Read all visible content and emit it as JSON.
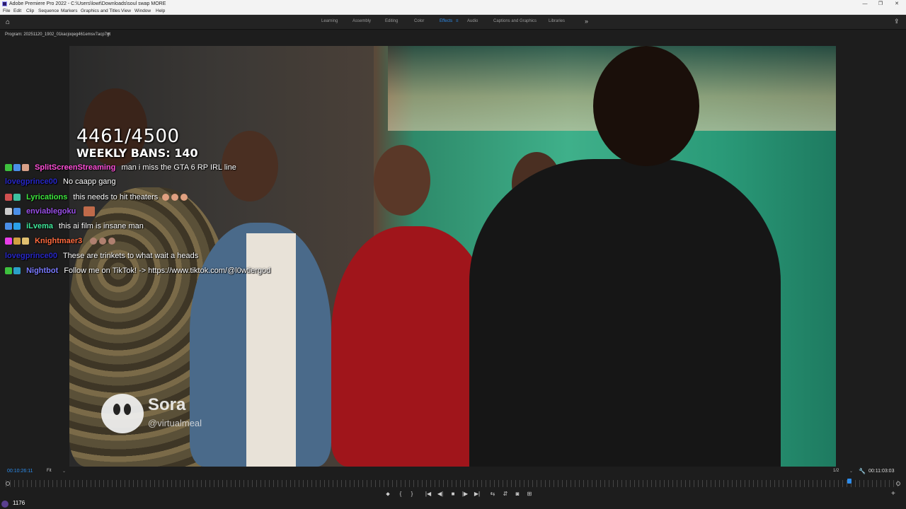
{
  "window": {
    "title": "Adobe Premiere Pro 2022 - C:\\Users\\lowt\\Downloads\\soul swap MORE",
    "controls": [
      "—",
      "❐",
      "✕"
    ]
  },
  "menu": [
    "File",
    "Edit",
    "Clip",
    "Sequence",
    "Markers",
    "Graphics and Titles",
    "View",
    "Window",
    "Help"
  ],
  "workspaces": {
    "items": [
      "Learning",
      "Assembly",
      "Editing",
      "Color",
      "Effects",
      "Audio",
      "Captions and Graphics",
      "Libraries"
    ],
    "active": "Effects",
    "active_menu_icon": "≡",
    "more": "»"
  },
  "panel": {
    "tab": "Program: 20251120_1902_01kacjoqeg461emsv7acp7gt",
    "menu_icon": "≡"
  },
  "video_overlay": {
    "count": "4461/4500",
    "bans": "WEEKLY BANS: 140"
  },
  "chat": [
    {
      "user": "SplitScreenStreaming",
      "color": "#ff4fd8",
      "message": "man i miss the GTA 6 RP IRL line",
      "badges": [
        "#3ec13e",
        "#4a8fe8",
        "#d8a088"
      ]
    },
    {
      "user": "lovegprince00",
      "color": "#2828c8",
      "message": "No caapp gang",
      "badges": []
    },
    {
      "user": "Lyrications",
      "color": "#3ee83e",
      "message": "this needs to hit theaters",
      "badges": [
        "#d05050",
        "#3ec1a0"
      ]
    },
    {
      "user": "enviablegoku",
      "color": "#9a4fe8",
      "message": "",
      "badges": [
        "#cccccc",
        "#4a8fe8"
      ]
    },
    {
      "user": "iLvema",
      "color": "#3ee89a",
      "message": "this ai film is insane man",
      "badges": [
        "#4a8fe8",
        "#2aa0e8"
      ]
    },
    {
      "user": "Knightmaer3",
      "color": "#ff6a3e",
      "message": "",
      "badges": [
        "#e83ee8",
        "#d0a040",
        "#e0c070"
      ]
    },
    {
      "user": "lovegprince00",
      "color": "#2828c8",
      "message": "These are trinkets to what wait a heads",
      "badges": []
    },
    {
      "user": "Nightbot",
      "color": "#7a7aff",
      "message": "Follow me on TikTok! -> https://www.tiktok.com/@l0wtiergod",
      "badges": [
        "#3ec13e",
        "#2aa0c8"
      ]
    }
  ],
  "watermark": {
    "name": "Sora",
    "handle": "@virtualmeal"
  },
  "controls": {
    "timecode_left": "00:10:26:11",
    "fit": "Fit",
    "quality": "1/2",
    "timecode_right": "00:11:03:03",
    "buttons": [
      "⬥",
      "{",
      "}",
      "|◀",
      "◀|",
      "■",
      "|▶",
      "▶|",
      "⇆",
      "⇵",
      "◙",
      "⊞"
    ],
    "add": "+"
  },
  "taskbar_count": "1176"
}
